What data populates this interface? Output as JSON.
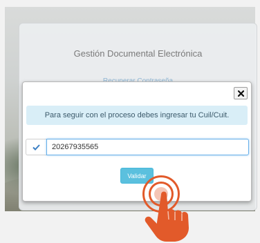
{
  "background": {
    "title": "Gestión Documental Electrónica",
    "link_text": "Recuperar Contraseña"
  },
  "modal": {
    "message": "Para seguir con el proceso debes ingresar tu Cuil/Cuit.",
    "input": {
      "value": "20267935565",
      "placeholder": ""
    },
    "input_icon": "checkmark-icon",
    "close_icon": "close-icon",
    "submit_label": "Validar"
  },
  "overlay": {
    "gesture": "tap",
    "icon": "pointing-hand-icon"
  },
  "colors": {
    "info_bg": "#d9eef7",
    "button": "#5bc0de",
    "check": "#3a7fc4",
    "gesture": "#e25a2a"
  }
}
